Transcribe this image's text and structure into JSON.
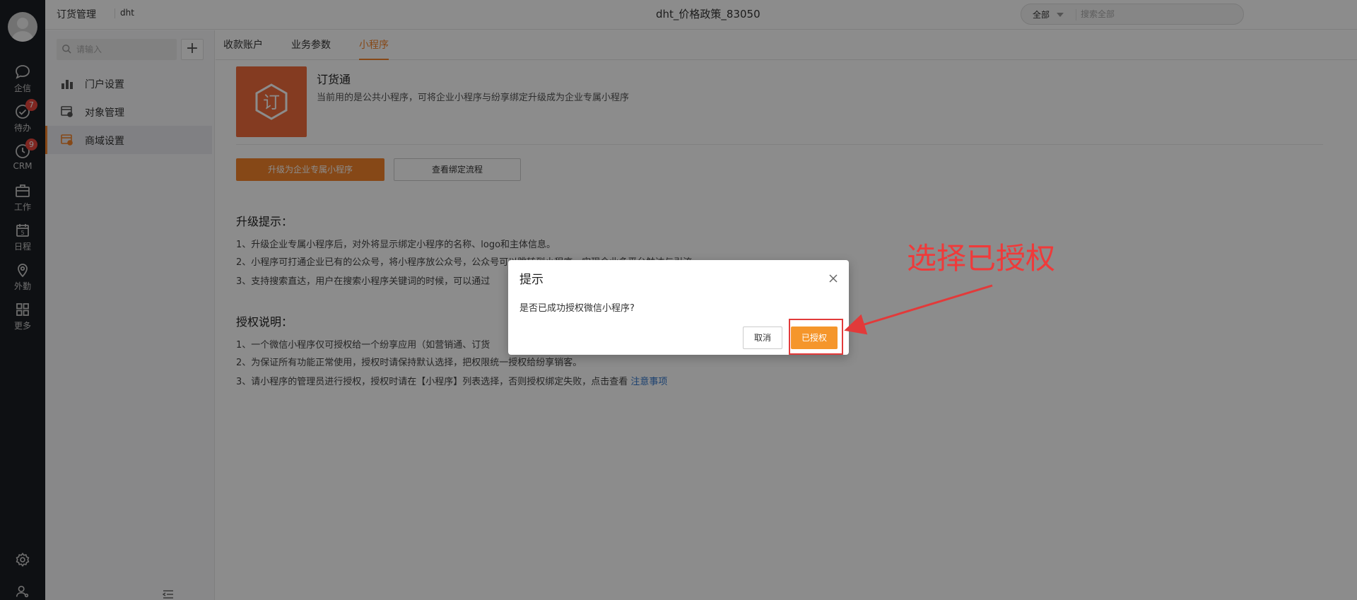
{
  "colors": {
    "accent": "#f5842b",
    "annotation": "#e23a3a",
    "rail": "#1b1e24",
    "link": "#3377cc"
  },
  "rail": {
    "items": [
      {
        "label": "企信",
        "icon": "chat-bubble-icon"
      },
      {
        "label": "待办",
        "icon": "check-circle-icon",
        "badge": "7"
      },
      {
        "label": "CRM",
        "icon": "clock-icon",
        "badge": "9"
      },
      {
        "label": "工作",
        "icon": "briefcase-icon"
      },
      {
        "label": "日程",
        "icon": "calendar-icon",
        "day": "5"
      },
      {
        "label": "外勤",
        "icon": "location-pin-icon"
      },
      {
        "label": "更多",
        "icon": "grid-icon"
      }
    ]
  },
  "topbar": {
    "app_title": "订货管理",
    "org_name": "dht",
    "center_title": "dht_价格政策_83050",
    "search_scope": "全部",
    "search_placeholder": "搜索全部"
  },
  "sidebar": {
    "search_placeholder": "请输入",
    "add_label": "+",
    "items": [
      {
        "label": "门户设置",
        "icon": "bar-chart-icon"
      },
      {
        "label": "对象管理",
        "icon": "object-settings-icon"
      },
      {
        "label": "商域设置",
        "icon": "shop-settings-icon",
        "active": true
      }
    ]
  },
  "tabs": [
    {
      "label": "收款账户"
    },
    {
      "label": "业务参数"
    },
    {
      "label": "小程序",
      "active": true
    }
  ],
  "miniprogram": {
    "logo_text": "订",
    "name": "订货通",
    "description": "当前用的是公共小程序，可将企业小程序与纷享绑定升级成为企业专属小程序",
    "upgrade_button": "升级为企业专属小程序",
    "flow_button": "查看绑定流程"
  },
  "upgrade_tips": {
    "title": "升级提示：",
    "lines": [
      "1、升级企业专属小程序后，对外将显示绑定小程序的名称、logo和主体信息。",
      "2、小程序可打通企业已有的公众号，将小程序放公众号，公众号可以跳转到小程序，实现企业多平台触达与引流",
      "3、支持搜索直达，用户在搜索小程序关键词的时候，可以通过"
    ]
  },
  "auth_notes": {
    "title": "授权说明：",
    "lines": [
      "1、一个微信小程序仅可授权给一个纷享应用（如营销通、订货",
      "2、为保证所有功能正常使用，授权时请保持默认选择，把权限统一授权给纷享销客。",
      "3、请小程序的管理员进行授权，授权时请在【小程序】列表选择，否则授权绑定失败，点击查看 "
    ],
    "link": "注意事项"
  },
  "dialog": {
    "title": "提示",
    "message": "是否已成功授权微信小程序?",
    "cancel": "取消",
    "confirm": "已授权"
  },
  "annotation": {
    "text": "选择已授权"
  }
}
